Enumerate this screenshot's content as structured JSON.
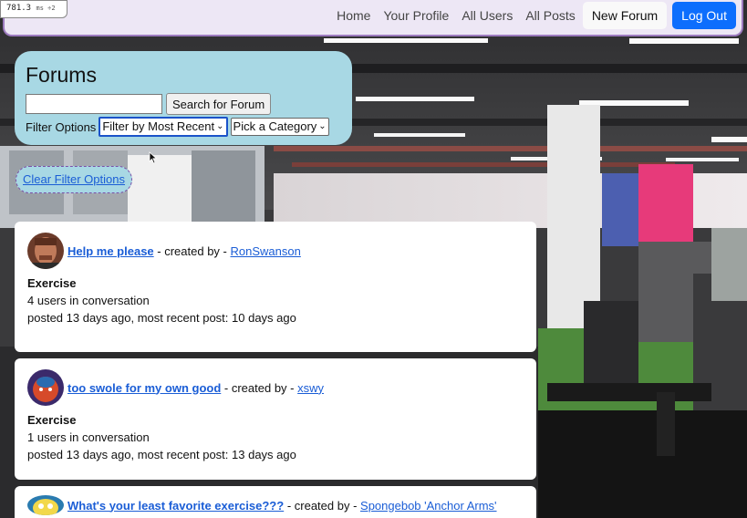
{
  "perf_meter": {
    "value": "781.3",
    "unit": "ms ÷2"
  },
  "nav": {
    "home": "Home",
    "profile": "Your Profile",
    "users": "All Users",
    "posts": "All Posts",
    "new_forum": "New Forum",
    "logout": "Log Out"
  },
  "forums_panel": {
    "title": "Forums",
    "search_value": "",
    "search_button": "Search for Forum",
    "filter_label": "Filter Options",
    "sort_select": "Filter by Most Recent",
    "category_select": "Pick a Category"
  },
  "clear_filter": "Clear Filter Options",
  "forums": [
    {
      "title": "Help me please",
      "created_by_prefix": "- created by -",
      "creator": "RonSwanson",
      "category": "Exercise",
      "users_line": "4 users in conversation",
      "posted_line": "posted 13 days ago, most recent post: 10 days ago",
      "avatar_icon": "man-portrait-icon"
    },
    {
      "title": "too swole for my own good",
      "created_by_prefix": "- created by -",
      "creator": "xswy",
      "category": "Exercise",
      "users_line": "1 users in conversation",
      "posted_line": "posted 13 days ago, most recent post: 13 days ago",
      "avatar_icon": "cartoon-avatar-icon"
    },
    {
      "title": "What's your least favorite exercise???",
      "created_by_prefix": "- created by -",
      "creator": "Spongebob 'Anchor Arms'",
      "avatar_icon": "spongebob-avatar-icon"
    }
  ],
  "colors": {
    "nav_bg": "#ede7f5",
    "primary": "#0d6efd",
    "panel_bg": "#a8d8e4",
    "link": "#1a5dd6"
  }
}
